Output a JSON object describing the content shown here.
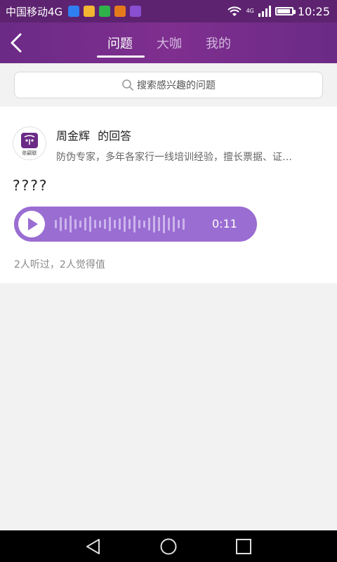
{
  "status_bar": {
    "carrier": "中国移动4G",
    "network_type": "4G",
    "time": "10:25",
    "notification_icons": [
      {
        "name": "shield-app-icon",
        "color": "#2f7ef2"
      },
      {
        "name": "bag-app-icon",
        "color": "#f2b632"
      },
      {
        "name": "chat-app-icon",
        "color": "#2fb24a"
      },
      {
        "name": "heart-app-icon",
        "color": "#e57a1a"
      },
      {
        "name": "image-app-icon",
        "color": "#8a4fd0"
      }
    ]
  },
  "header": {
    "tabs": [
      {
        "label": "问题",
        "active": true
      },
      {
        "label": "大咖",
        "active": false
      },
      {
        "label": "我的",
        "active": false
      }
    ]
  },
  "search": {
    "placeholder": "搜索感兴趣的问题"
  },
  "answer": {
    "expert_name": "周金辉",
    "suffix": "的回答",
    "bio": "防伪专家，多年各家行一线培训经验，擅长票据、证…",
    "avatar_text": "依嗣联",
    "question": "????",
    "voice_duration": "0:11",
    "stats": "2人听过，2人觉得值"
  },
  "colors": {
    "header": "#7a2d8c",
    "voice_bubble": "#9a6dd2"
  }
}
